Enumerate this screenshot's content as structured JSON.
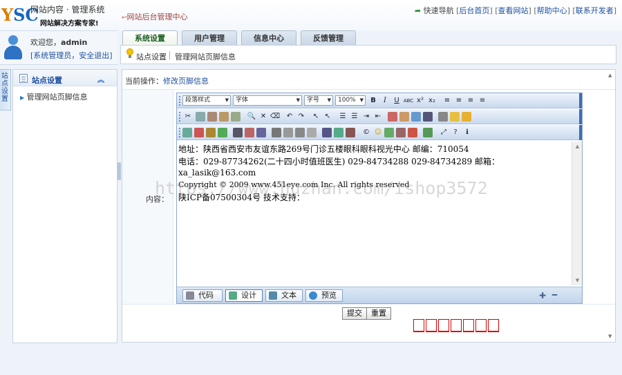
{
  "header": {
    "logo_text": "YSC",
    "logo_title": "网站内容 · 管理系统",
    "logo_slogan": "网站解决方案专家!",
    "center_title": "网站后台管理中心",
    "quick_nav_label": "快速导航",
    "links": [
      "后台首页",
      "查看网站",
      "帮助中心",
      "联系开发者"
    ]
  },
  "user": {
    "welcome_prefix": "欢迎您，",
    "username": "admin",
    "links_text": "[系统管理员，安全退出]"
  },
  "tabs": [
    {
      "label": "系统设置",
      "active": true
    },
    {
      "label": "用户管理",
      "active": false
    },
    {
      "label": "信息中心",
      "active": false
    },
    {
      "label": "反馈管理",
      "active": false
    }
  ],
  "subnav": [
    "站点设置",
    "管理网站页脚信息"
  ],
  "side_handle": "站点设置",
  "sidebar": {
    "title": "站点设置",
    "items": [
      "管理网站页脚信息"
    ]
  },
  "breadcrumb": {
    "prefix": "当前操作：",
    "current": "修改页脚信息"
  },
  "form": {
    "content_label": "内容："
  },
  "editor": {
    "selects": [
      "段落样式",
      "字体",
      "字号",
      "100%"
    ],
    "format_buttons": [
      "B",
      "I",
      "U",
      "ABC",
      "x²",
      "x₂"
    ],
    "content_lines": [
      "地址：陕西省西安市友谊东路269号门诊五楼眼科眼科视光中心  邮编：710054",
      "电话：029-87734262(二十四小时值班医生) 029-84734288 029-84734289 邮箱：",
      "xa_lasik@163.com",
      "Copyright © 2009 www.451eye.com Inc. All rights reserved",
      "陕ICP备07500304号  技术支持："
    ],
    "modes": [
      {
        "label": "代码",
        "active": false
      },
      {
        "label": "设计",
        "active": true
      },
      {
        "label": "文本",
        "active": false
      },
      {
        "label": "预览",
        "active": false
      }
    ]
  },
  "buttons": {
    "submit": "提交",
    "reset": "重置"
  },
  "watermark": "https://www.huzhan.com/ishop3572",
  "colors": {
    "accent": "#1f4f9f",
    "tab_active_text": "#1b5e20",
    "toolbar_edge": "#3d6fb0"
  }
}
